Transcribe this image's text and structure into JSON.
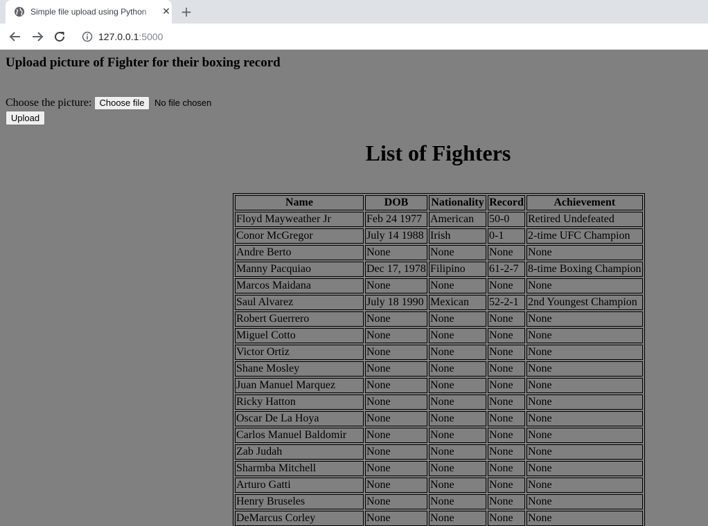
{
  "browser": {
    "tab_title": "Simple file upload using Python",
    "url_host": "127.0.0.1",
    "url_port": ":5000"
  },
  "page": {
    "upload_heading": "Upload picture of Fighter for their boxing record",
    "choose_label": "Choose the picture:",
    "choose_file_button": "Choose file",
    "no_file_text": "No file chosen",
    "upload_button": "Upload",
    "list_title": "List of Fighters"
  },
  "table": {
    "headers": [
      "Name",
      "DOB",
      "Nationality",
      "Record",
      "Achievement"
    ],
    "rows": [
      [
        "Floyd Mayweather Jr",
        "Feb 24 1977",
        "American",
        "50-0",
        "Retired Undefeated"
      ],
      [
        "Conor McGregor",
        "July 14 1988",
        "Irish",
        "0-1",
        "2-time UFC Champion"
      ],
      [
        "Andre Berto",
        "None",
        "None",
        "None",
        "None"
      ],
      [
        "Manny Pacquiao",
        "Dec 17, 1978",
        "Filipino",
        "61-2-7",
        "8-time Boxing Champion"
      ],
      [
        "Marcos Maidana",
        "None",
        "None",
        "None",
        "None"
      ],
      [
        "Saul Alvarez",
        "July 18 1990",
        "Mexican",
        "52-2-1",
        "2nd Youngest Champion"
      ],
      [
        "Robert Guerrero",
        "None",
        "None",
        "None",
        "None"
      ],
      [
        "Miguel Cotto",
        "None",
        "None",
        "None",
        "None"
      ],
      [
        "Victor Ortiz",
        "None",
        "None",
        "None",
        "None"
      ],
      [
        "Shane Mosley",
        "None",
        "None",
        "None",
        "None"
      ],
      [
        "Juan Manuel Marquez",
        "None",
        "None",
        "None",
        "None"
      ],
      [
        "Ricky Hatton",
        "None",
        "None",
        "None",
        "None"
      ],
      [
        "Oscar De La Hoya",
        "None",
        "None",
        "None",
        "None"
      ],
      [
        "Carlos Manuel Baldomir",
        "None",
        "None",
        "None",
        "None"
      ],
      [
        "Zab Judah",
        "None",
        "None",
        "None",
        "None"
      ],
      [
        "Sharmba Mitchell",
        "None",
        "None",
        "None",
        "None"
      ],
      [
        "Arturo Gatti",
        "None",
        "None",
        "None",
        "None"
      ],
      [
        "Henry Bruseles",
        "None",
        "None",
        "None",
        "None"
      ],
      [
        "DeMarcus Corley",
        "None",
        "None",
        "None",
        "None"
      ]
    ]
  },
  "icons": {
    "tab_favicon": "globe-icon",
    "tab_close": "close-icon",
    "new_tab": "plus-icon",
    "back": "arrow-left-icon",
    "forward": "arrow-right-icon",
    "reload": "reload-icon",
    "site_info": "info-icon"
  }
}
